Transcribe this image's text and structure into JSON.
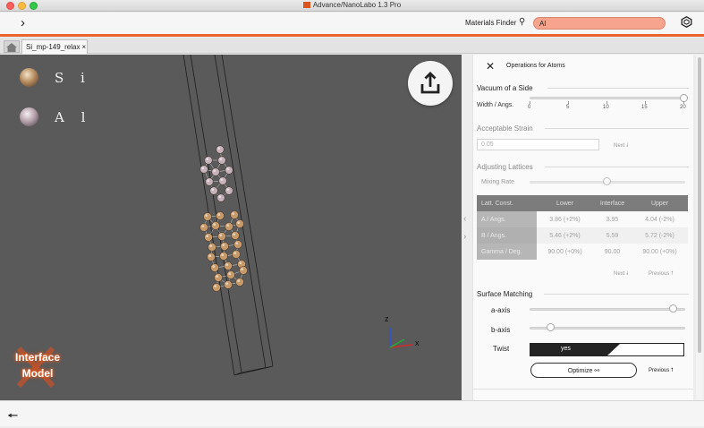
{
  "window": {
    "title": "Advance/NanoLabo 1.3 Pro"
  },
  "toolbar": {
    "forward_icon": "chevron-right-icon",
    "materials_finder_label": "Materials Finder",
    "search_value": "Al"
  },
  "tabs": [
    {
      "label": "Si_mp-149_relax",
      "close": "×"
    }
  ],
  "viewer": {
    "legend": [
      {
        "symbol": "S i",
        "color": "#c79a6a"
      },
      {
        "symbol": "A l",
        "color": "#c6b3bc"
      }
    ],
    "axes": {
      "x": "x",
      "y": "y",
      "z": "z"
    },
    "logo": {
      "line1": "Interface",
      "line2": "Model"
    }
  },
  "panel": {
    "ops_label": "Operations for Atoms",
    "vacuum": {
      "title": "Vacuum of a Side",
      "label": "Width / Angs.",
      "ticks": [
        "0",
        "5",
        "10",
        "15",
        "20"
      ],
      "value": 20
    },
    "strain": {
      "title": "Acceptable Strain",
      "value": "0.05",
      "next": "Next"
    },
    "lattice": {
      "title": "Adjusting Lattices",
      "mixing_label": "Mixing Rate",
      "columns": [
        "Latt. Const.",
        "Lower",
        "Interface",
        "Upper"
      ],
      "rows": [
        [
          "A / Angs.",
          "3.86 (+2%)",
          "3.95",
          "4.04 (-2%)"
        ],
        [
          "B / Angs.",
          "5.46 (+2%)",
          "5.59",
          "5.72 (-2%)"
        ],
        [
          "Gamma / Deg.",
          "90.00 (+0%)",
          "90.00",
          "90.00 (+0%)"
        ]
      ],
      "next": "Next",
      "previous": "Previous"
    },
    "surface": {
      "title": "Surface Matching",
      "a_axis": "a-axis",
      "b_axis": "b-axis",
      "twist": "Twist",
      "twist_value": "yes",
      "optimize": "Optimize",
      "previous": "Previous"
    }
  }
}
